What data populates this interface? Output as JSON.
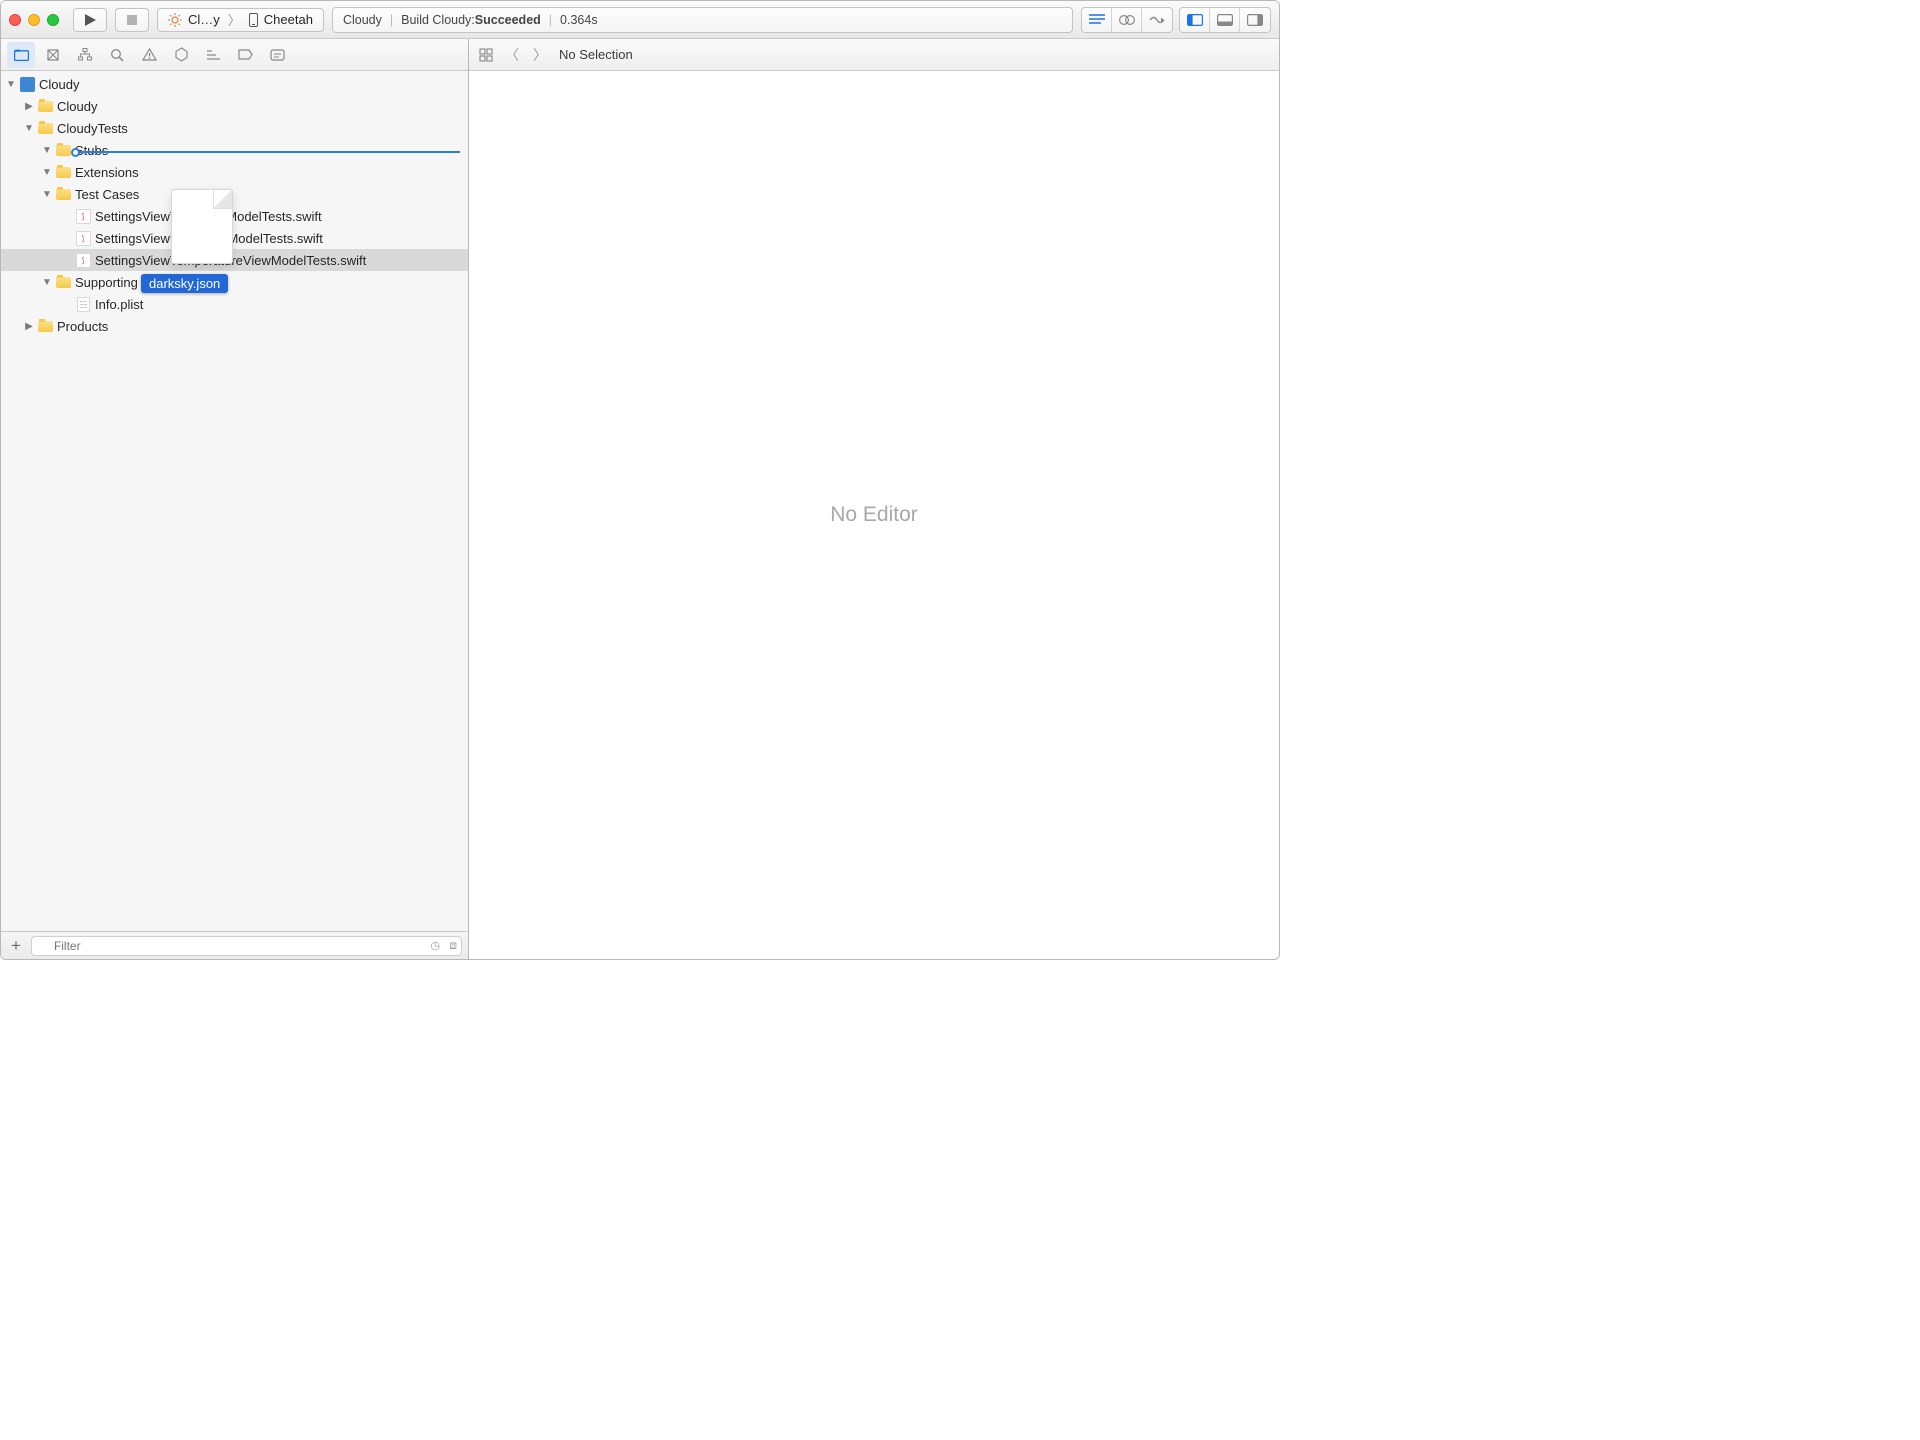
{
  "toolbar": {
    "scheme_name": "Cl…y",
    "destination": "Cheetah"
  },
  "status": {
    "project": "Cloudy",
    "action_prefix": "Build Cloudy: ",
    "action_result": "Succeeded",
    "time": "0.364s"
  },
  "navigator": {
    "root": "Cloudy",
    "items": {
      "cloudy_folder": "Cloudy",
      "cloudy_tests": "CloudyTests",
      "stubs": "Stubs",
      "extensions": "Extensions",
      "test_cases": "Test Cases",
      "tc1": "SettingsViewTimeViewModelTests.swift",
      "tc2": "SettingsViewUnitsViewModelTests.swift",
      "tc3": "SettingsViewTemperatureViewModelTests.swift",
      "supporting": "Supporting Files",
      "info_plist": "Info.plist",
      "products": "Products"
    }
  },
  "filter": {
    "placeholder": "Filter"
  },
  "jump_bar": {
    "selection": "No Selection"
  },
  "editor": {
    "empty": "No Editor"
  },
  "drag": {
    "filename": "darksky.json"
  }
}
